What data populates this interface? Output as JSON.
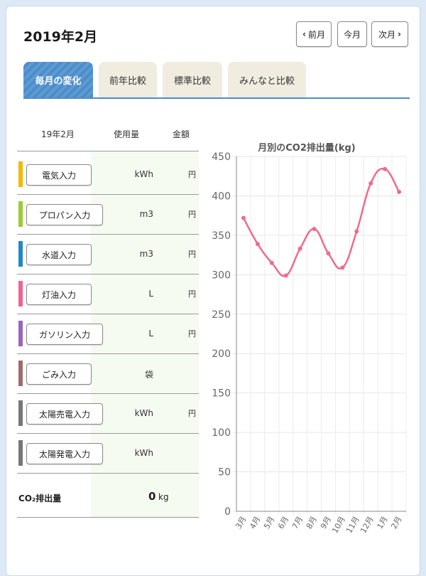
{
  "header": {
    "title": "2019年2月",
    "prev_label": "前月",
    "today_label": "今月",
    "next_label": "次月"
  },
  "tabs": [
    {
      "label": "毎月の変化",
      "active": true
    },
    {
      "label": "前年比較",
      "active": false
    },
    {
      "label": "標準比較",
      "active": false
    },
    {
      "label": "みんなと比較",
      "active": false
    }
  ],
  "table": {
    "headers": [
      "19年2月",
      "使用量",
      "金額"
    ],
    "rows": [
      {
        "label": "電気入力",
        "color": "#f5b800",
        "unit": "kWh",
        "yen": "円"
      },
      {
        "label": "プロパン入力",
        "color": "#9acd32",
        "unit": "m3",
        "yen": "円"
      },
      {
        "label": "水道入力",
        "color": "#1e88c8",
        "unit": "m3",
        "yen": "円"
      },
      {
        "label": "灯油入力",
        "color": "#f06292",
        "unit": "L",
        "yen": "円"
      },
      {
        "label": "ガソリン入力",
        "color": "#9c64b8",
        "unit": "L",
        "yen": "円"
      },
      {
        "label": "ごみ入力",
        "color": "#9e6b6b",
        "unit": "袋",
        "yen": ""
      },
      {
        "label": "太陽売電入力",
        "color": "#777777",
        "unit": "kWh",
        "yen": "円"
      },
      {
        "label": "太陽発電入力",
        "color": "#777777",
        "unit": "kWh",
        "yen": ""
      }
    ],
    "co2": {
      "label": "CO₂排出量",
      "value": "0",
      "unit": "kg"
    }
  },
  "chart_data": {
    "type": "line",
    "title": "月別のCO2排出量(kg)",
    "categories": [
      "3月",
      "4月",
      "5月",
      "6月",
      "7月",
      "8月",
      "9月",
      "10月",
      "11月",
      "12月",
      "1月",
      "2月"
    ],
    "values": [
      372,
      339,
      315,
      299,
      333,
      358,
      327,
      309,
      355,
      416,
      434,
      405
    ],
    "ylim": [
      0,
      450
    ],
    "yticks": [
      0,
      50,
      100,
      150,
      200,
      250,
      300,
      350,
      400,
      450
    ],
    "line_color": "#f06b8c",
    "grid": true
  }
}
